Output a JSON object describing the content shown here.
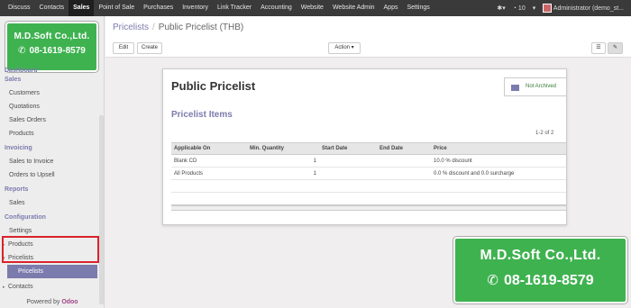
{
  "topnav": {
    "items": [
      "Discuss",
      "Contacts",
      "Sales",
      "Point of Sale",
      "Purchases",
      "Inventory",
      "Link Tracker",
      "Accounting",
      "Website",
      "Website Admin",
      "Apps",
      "Settings"
    ],
    "active": "Sales",
    "notif_count": "10",
    "user": "Administrator (demo_st..."
  },
  "logo": {
    "company": "M.D.Soft Co.,Ltd.",
    "phone": "08-1619-8579"
  },
  "sidebar": {
    "dashboard": "Dashboard",
    "sales_section": "Sales",
    "sales_items": [
      "Customers",
      "Quotations",
      "Sales Orders",
      "Products"
    ],
    "invoicing_section": "Invoicing",
    "invoicing_items": [
      "Sales to Invoice",
      "Orders to Upsell"
    ],
    "reports_section": "Reports",
    "reports_items": [
      "Sales"
    ],
    "config_section": "Configuration",
    "config_items": [
      "Settings",
      "Products",
      "Pricelists",
      "Pricelists",
      "Contacts"
    ],
    "powered_prefix": "Powered by",
    "powered_brand": "Odoo"
  },
  "breadcrumb": {
    "parent": "Pricelists",
    "separator": "/",
    "current": "Public Pricelist (THB)"
  },
  "toolbar": {
    "edit": "Edit",
    "create": "Create",
    "action": "Action ▾"
  },
  "form": {
    "title": "Public Pricelist",
    "archive_label": "Not Archived",
    "items_heading": "Pricelist Items",
    "pager": "1-2 of 2",
    "columns": [
      "Applicable On",
      "Min. Quantity",
      "Start Date",
      "End Date",
      "Price"
    ],
    "rows": [
      {
        "applicable_on": "Blank CD",
        "min_qty": "1",
        "start": "",
        "end": "",
        "price": "10.0 % discount"
      },
      {
        "applicable_on": "All Products",
        "min_qty": "1",
        "start": "",
        "end": "",
        "price": "0.0 % discount and 0.0 surcharge"
      }
    ]
  },
  "promo": {
    "company": "M.D.Soft Co.,Ltd.",
    "phone": "08-1619-8579"
  },
  "colors": {
    "accent": "#7c7bad",
    "brand_green": "#3fb250",
    "highlight_red": "#d9232b",
    "topbar": "#3a3a3a"
  }
}
